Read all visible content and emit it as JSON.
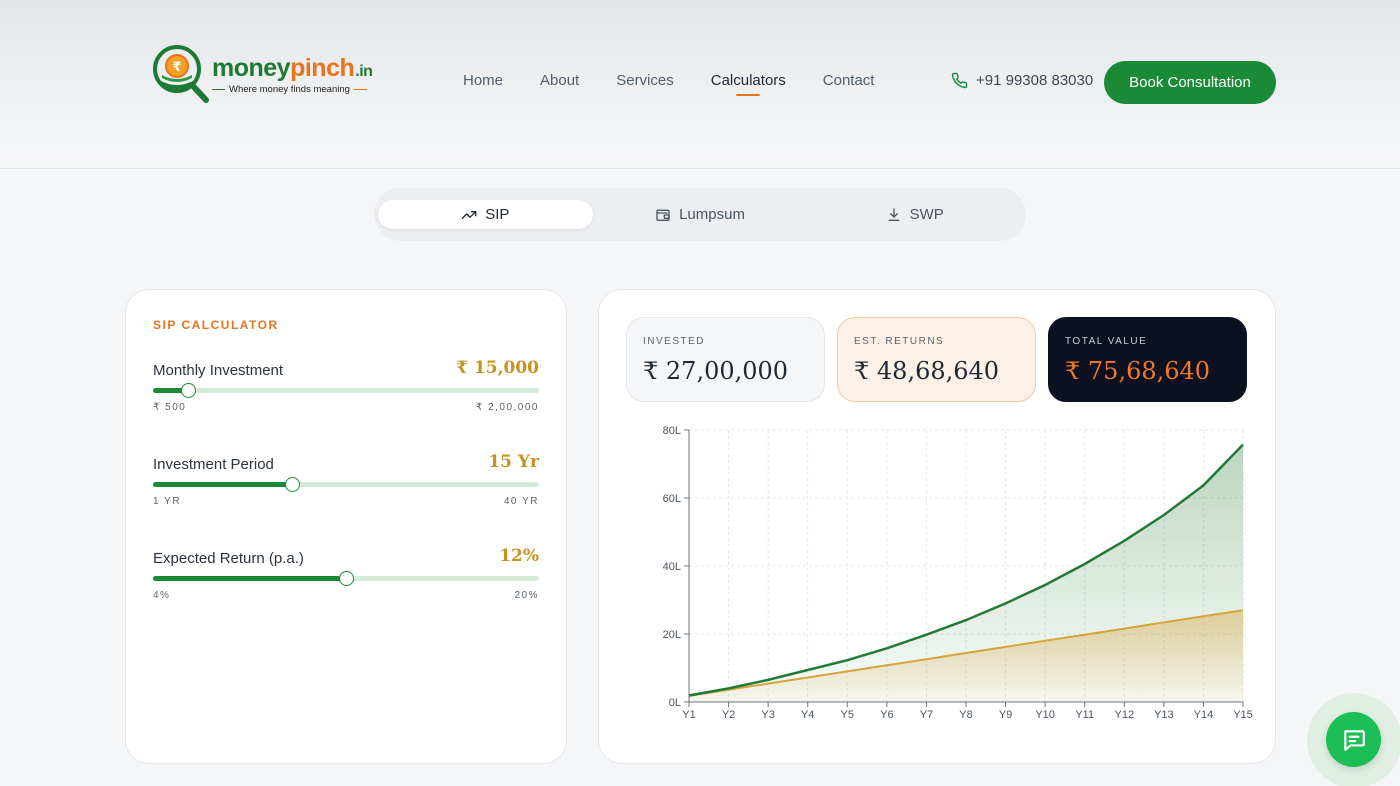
{
  "brand": {
    "name_part1": "money",
    "name_part2": "pinch",
    "name_tld": ".in",
    "tagline": "Where money finds meaning",
    "logo_symbol": "₹",
    "colors": {
      "green": "#1e7a32",
      "orange": "#e8731d"
    }
  },
  "nav": {
    "items": [
      {
        "label": "Home"
      },
      {
        "label": "About"
      },
      {
        "label": "Services"
      },
      {
        "label": "Calculators",
        "active": true
      },
      {
        "label": "Contact"
      }
    ],
    "phone": "+91 99308 83030",
    "phone_icon": "phone-icon",
    "cta": "Book Consultation"
  },
  "tabs": [
    {
      "label": "SIP",
      "icon": "trending-up-icon",
      "active": true
    },
    {
      "label": "Lumpsum",
      "icon": "wallet-icon"
    },
    {
      "label": "SWP",
      "icon": "download-icon"
    }
  ],
  "calculator": {
    "heading": "SIP CALCULATOR",
    "sliders": [
      {
        "label": "Monthly Investment",
        "value": "₹ 15,000",
        "min_label": "₹ 500",
        "max_label": "₹ 2,00,000",
        "level": 0.09
      },
      {
        "label": "Investment Period",
        "value": "15 Yr",
        "min_label": "1 YR",
        "max_label": "40 YR",
        "level": 0.36
      },
      {
        "label": "Expected Return (p.a.)",
        "value": "12%",
        "min_label": "4%",
        "max_label": "20%",
        "level": 0.5
      }
    ]
  },
  "results": {
    "invested": {
      "label": "INVESTED",
      "value": "₹ 27,00,000"
    },
    "returns": {
      "label": "EST. RETURNS",
      "value": "₹ 48,68,640"
    },
    "total": {
      "label": "TOTAL VALUE",
      "value": "₹ 75,68,640"
    }
  },
  "chart_data": {
    "type": "area",
    "categories": [
      "Y1",
      "Y2",
      "Y3",
      "Y4",
      "Y5",
      "Y6",
      "Y7",
      "Y8",
      "Y9",
      "Y10",
      "Y11",
      "Y12",
      "Y13",
      "Y14",
      "Y15"
    ],
    "y_ticks": [
      "0L",
      "20L",
      "40L",
      "60L",
      "80L"
    ],
    "ylim": [
      0,
      80
    ],
    "grid": true,
    "series": [
      {
        "key": "total",
        "values": [
          1.9,
          4.0,
          6.5,
          9.4,
          12.3,
          15.8,
          19.8,
          24.1,
          29.0,
          34.4,
          40.6,
          47.4,
          55.0,
          63.7,
          75.7
        ],
        "color": "#237a35"
      },
      {
        "key": "invested",
        "values": [
          1.8,
          3.6,
          5.4,
          7.2,
          9.0,
          10.8,
          12.6,
          14.4,
          16.2,
          18.0,
          19.8,
          21.6,
          23.4,
          25.2,
          27.0
        ],
        "color": "#d4a53c"
      }
    ]
  },
  "chat": {
    "icon": "chat-icon"
  }
}
